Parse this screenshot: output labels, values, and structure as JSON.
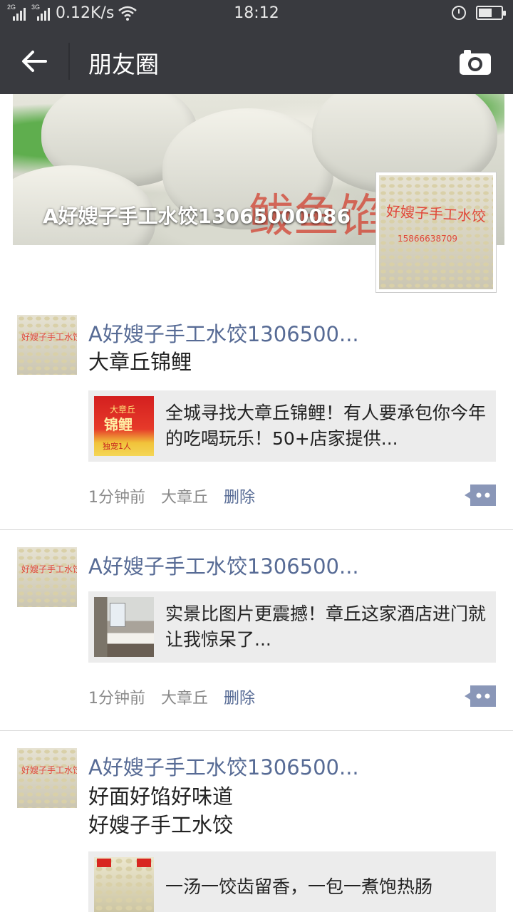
{
  "status_bar": {
    "network_1": "2G",
    "network_2": "3G",
    "speed": "0.12K/s",
    "time": "18:12",
    "battery_level": 0.6
  },
  "title_bar": {
    "title": "朋友圈",
    "back_icon": "arrow-left-icon",
    "camera_icon": "camera-icon"
  },
  "cover": {
    "name": "A好嫂子手工水饺13065000086",
    "overlay_text": "鲅鱼馅",
    "avatar_text": "好嫂子手工水饺",
    "avatar_phone": "15866638709"
  },
  "posts": [
    {
      "author": "A好嫂子手工水饺1306500...",
      "avatar_text": "好嫂子手工水饺",
      "text": "大章丘锦鲤",
      "card": {
        "text": "全城寻找大章丘锦鲤！有人要承包你今年的吃喝玩乐！50+店家提供...",
        "thumb_top": "大章丘",
        "thumb_main": "锦鲤",
        "thumb_bottom": "独宠1人"
      },
      "time": "1分钟前",
      "location": "大章丘",
      "delete": "删除"
    },
    {
      "author": "A好嫂子手工水饺1306500...",
      "avatar_text": "好嫂子手工水饺",
      "card": {
        "text": "实景比图片更震撼！章丘这家酒店进门就让我惊呆了..."
      },
      "time": "1分钟前",
      "location": "大章丘",
      "delete": "删除"
    },
    {
      "author": "A好嫂子手工水饺1306500...",
      "avatar_text": "好嫂子手工水饺",
      "text_line_1": "好面好馅好味道",
      "text_line_2": "好嫂子手工水饺",
      "card": {
        "text": "一汤一饺齿留香，一包一煮饱热肠"
      }
    }
  ]
}
